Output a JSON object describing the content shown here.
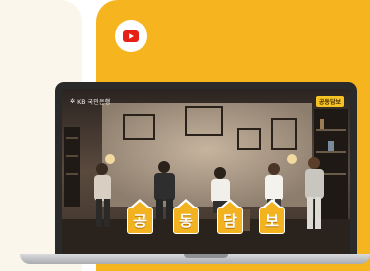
{
  "youtube": {
    "icon": "youtube-play-icon",
    "color": "#e62117"
  },
  "video": {
    "brand_label": "KB 국민은행",
    "corner_badge": "공동담보",
    "title_tiles": [
      "공",
      "동",
      "담",
      "보"
    ]
  },
  "colors": {
    "accent_yellow": "#f6b51f",
    "left_card": "#fbf6ec",
    "tile_yellow": "#f3b320"
  }
}
